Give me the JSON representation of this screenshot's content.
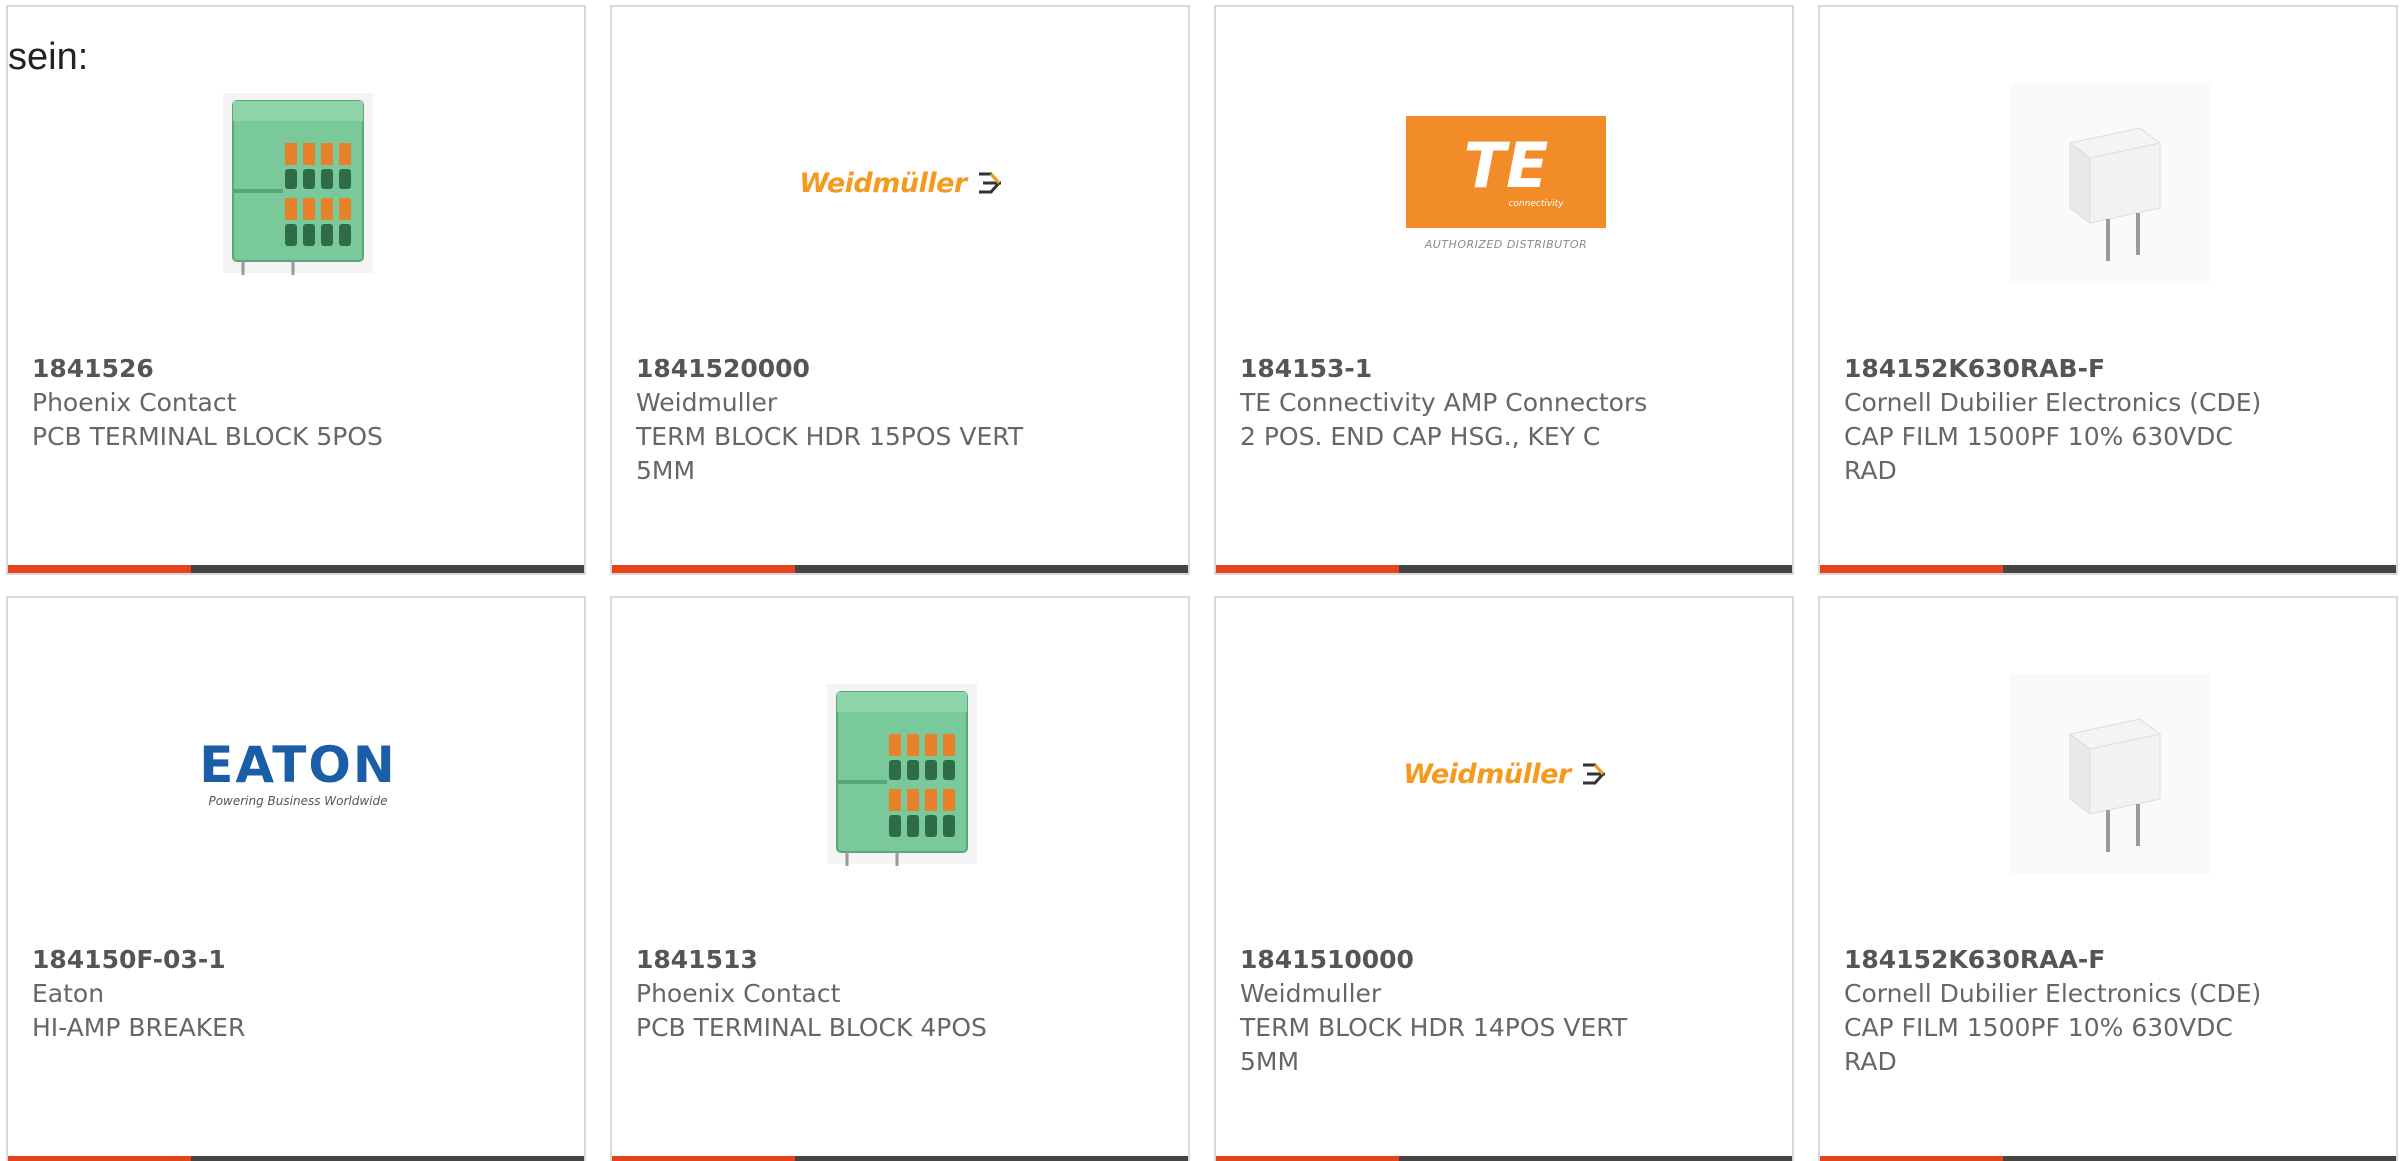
{
  "intro_text": "sein:",
  "logo_text": {
    "weidmuller": "Weidmüller",
    "te_mark": "TE",
    "te_sub": "connectivity",
    "te_distributor": "AUTHORIZED DISTRIBUTOR",
    "eaton": "EATON",
    "eaton_tagline": "Powering Business Worldwide"
  },
  "colors": {
    "accent_bar": "#e8421c",
    "bar_base": "#444444",
    "card_border": "#d9d9d9",
    "terminal_green": "#79c99a",
    "terminal_orange": "#e8822a",
    "weidmuller_orange": "#f49a1e",
    "te_orange": "#f28c28",
    "eaton_blue": "#1a5ea8"
  },
  "products": [
    {
      "part_number": "1841526",
      "manufacturer": "Phoenix Contact",
      "description": "PCB TERMINAL BLOCK 5POS",
      "image": "terminal-block-image"
    },
    {
      "part_number": "1841520000",
      "manufacturer": "Weidmuller",
      "description": "TERM BLOCK HDR 15POS VERT 5MM",
      "image": "weidmuller-logo"
    },
    {
      "part_number": "184153-1",
      "manufacturer": "TE Connectivity AMP Connectors",
      "description": "2 POS. END CAP HSG., KEY C",
      "image": "te-connectivity-logo"
    },
    {
      "part_number": "184152K630RAB-F",
      "manufacturer": "Cornell Dubilier Electronics (CDE)",
      "description": "CAP FILM 1500PF 10% 630VDC RAD",
      "image": "film-capacitor-image"
    },
    {
      "part_number": "184150F-03-1",
      "manufacturer": "Eaton",
      "description": "HI-AMP BREAKER",
      "image": "eaton-logo"
    },
    {
      "part_number": "1841513",
      "manufacturer": "Phoenix Contact",
      "description": "PCB TERMINAL BLOCK 4POS",
      "image": "terminal-block-image"
    },
    {
      "part_number": "1841510000",
      "manufacturer": "Weidmuller",
      "description": "TERM BLOCK HDR 14POS VERT 5MM",
      "image": "weidmuller-logo"
    },
    {
      "part_number": "184152K630RAA-F",
      "manufacturer": "Cornell Dubilier Electronics (CDE)",
      "description": "CAP FILM 1500PF 10% 630VDC RAD",
      "image": "film-capacitor-image"
    }
  ]
}
